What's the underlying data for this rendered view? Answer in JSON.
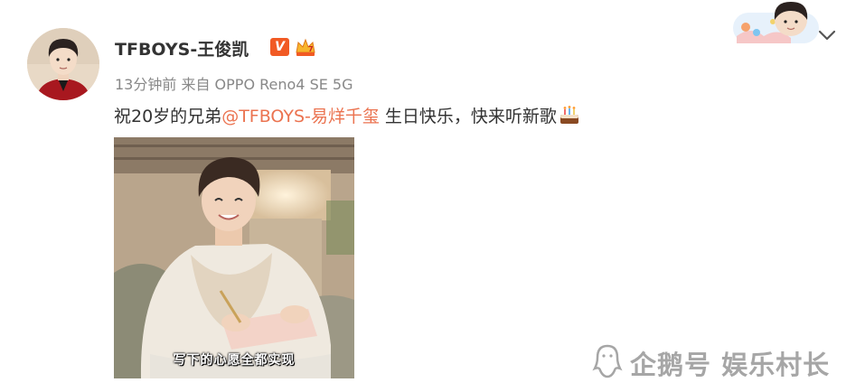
{
  "post": {
    "author": {
      "name": "TFBOYS-王俊凯",
      "verified_badge": "V",
      "avatar_icon": "avatar"
    },
    "meta": {
      "time_ago": "13分钟前",
      "source": "来自 OPPO Reno4 SE 5G"
    },
    "text": {
      "prefix": "祝20岁的兄弟",
      "mention": "@TFBOYS-易烊千玺",
      "suffix": " 生日快乐，快来听新歌",
      "emoji_icon": "birthday-cake-icon"
    },
    "image": {
      "subtitle": "写下的心愿全都实现"
    }
  },
  "header": {
    "expand_icon": "chevron-down-icon"
  },
  "watermark": {
    "text": "企鹅号 娱乐村长",
    "icon": "penguin-logo-icon"
  },
  "colors": {
    "mention": "#eb7350",
    "meta": "#888888",
    "text": "#333333",
    "badge": "#f15a24"
  }
}
